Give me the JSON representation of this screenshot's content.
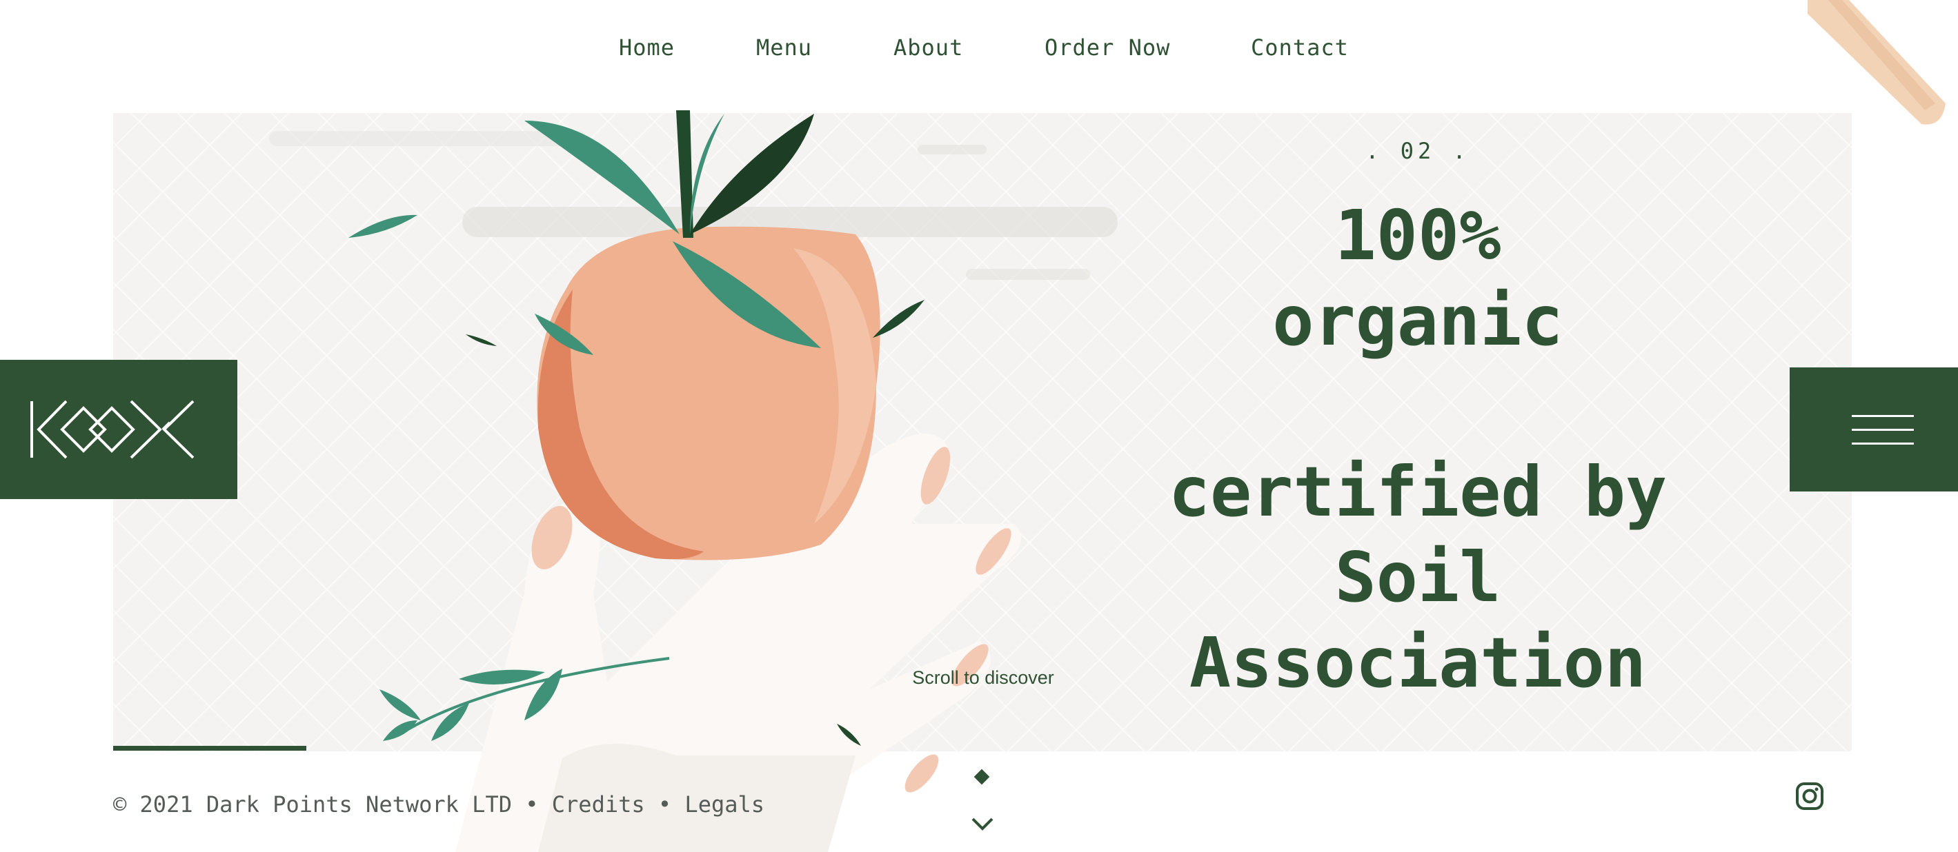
{
  "nav": {
    "items": [
      {
        "label": "Home"
      },
      {
        "label": "Menu"
      },
      {
        "label": "About"
      },
      {
        "label": "Order Now"
      },
      {
        "label": "Contact"
      }
    ]
  },
  "hero": {
    "slide_index": ". 02 .",
    "headline": {
      "line1": "100%",
      "line2": "organic",
      "line3": "certified by",
      "line4": "Soil",
      "line5": "Association"
    },
    "scroll_label": "Scroll to discover",
    "progress": 0.2
  },
  "footer": {
    "copyright": "© 2021 Dark Points Network LTD",
    "separator": "•",
    "credits": "Credits",
    "legals": "Legals"
  },
  "icons": {
    "logo": "koox-logo-icon",
    "menu": "hamburger-menu-icon",
    "scroll": "chevron-down-icon",
    "social": "instagram-icon"
  },
  "colors": {
    "brand_green": "#2e5233",
    "hero_bg": "#f4f3f1",
    "peach": "#efb18f",
    "leaf": "#3f9277"
  }
}
